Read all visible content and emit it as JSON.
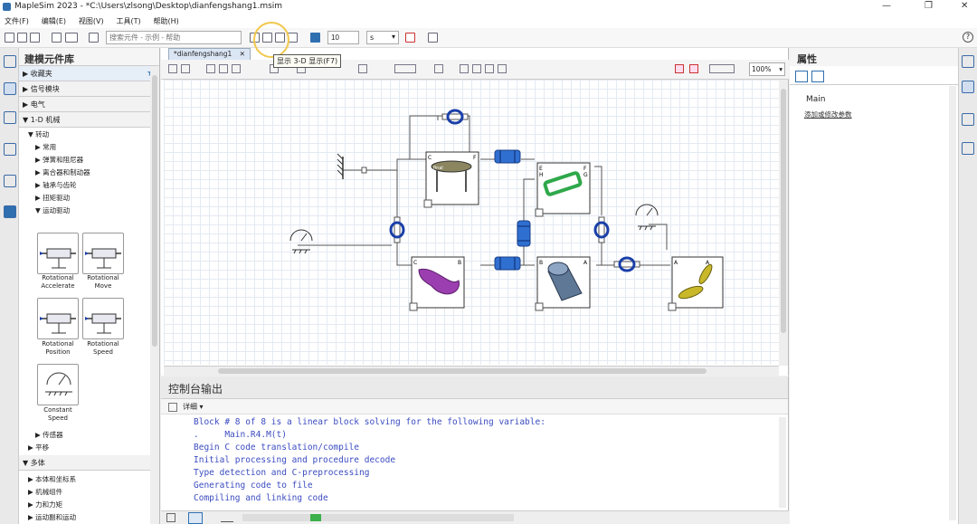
{
  "window": {
    "title": "MapleSim 2023 - *C:\\Users\\zlsong\\Desktop\\dianfengshang1.msim",
    "minimize": "—",
    "restore": "❐",
    "close": "✕"
  },
  "menu": [
    "文件(F)",
    "编辑(E)",
    "视图(V)",
    "工具(T)",
    "帮助(H)"
  ],
  "toolbar": {
    "search_placeholder": "搜索元件 - 示例 - 帮助",
    "sim_time": "10",
    "time_unit": "s",
    "help": "?",
    "tooltip": "显示 3-D 显示(F7)"
  },
  "library": {
    "title": "建模元件库",
    "sections": [
      "收藏夹",
      "信号模块",
      "电气",
      "1-D 机械"
    ],
    "tree_rotation": "转动",
    "tree_items": [
      "常用",
      "弹簧和阻尼器",
      "离合器和制动器",
      "轴承与齿轮",
      "扭矩驱动",
      "运动驱动"
    ],
    "palette": [
      {
        "label": "Rotational\nAccelerate"
      },
      {
        "label": "Rotational\nMove"
      },
      {
        "label": "Rotational\nPosition"
      },
      {
        "label": "Rotational\nSpeed"
      },
      {
        "label": "Constant\nSpeed"
      }
    ],
    "tree_after": [
      "传感器",
      "平移"
    ],
    "section_multibody": "多体",
    "multibody_items": [
      "本体和坐标系",
      "机械组件",
      "力和力矩",
      "运动副和运动"
    ]
  },
  "editor": {
    "tab": "*dianfengshang1",
    "zoom": "100%"
  },
  "diagram": {
    "ports": [
      "C",
      "F",
      "E",
      "H",
      "F",
      "G",
      "C",
      "B",
      "B",
      "A",
      "A",
      "A"
    ],
    "box_label": "final"
  },
  "console": {
    "title": "控制台输出",
    "detail": "详细",
    "lines": [
      "Block # 8 of 8 is a linear block solving for the following variable:",
      ".     Main.R4.M(t)",
      "Begin C code translation/compile",
      "Initial processing and procedure decode",
      "Type detection and C-preprocessing",
      "Generating code to file",
      "Compiling and linking code"
    ]
  },
  "properties": {
    "title": "属性",
    "model": "Main",
    "link": "添加或修改参数"
  },
  "colors": {
    "accent": "#2f6fb0",
    "console_text": "#3b4cc0",
    "highlight": "#f1c84d"
  }
}
